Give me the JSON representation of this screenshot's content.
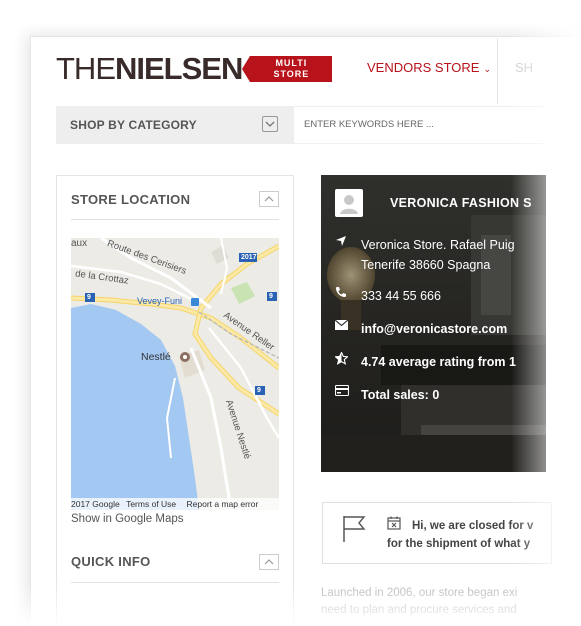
{
  "header": {
    "logo_thin": "THE",
    "logo_bold": "NIELSEN",
    "badge_line1": "MULTI",
    "badge_line2": "STORE",
    "nav_vendors": "VENDORS STORE",
    "nav_shop": "SH",
    "brand_color": "#b8121b"
  },
  "catbar": {
    "label": "SHOP BY CATEGORY",
    "toggle_icon": "chevron-down-icon"
  },
  "search": {
    "placeholder": "ENTER KEYWORDS HERE ..."
  },
  "sidebar": {
    "store_location_title": "STORE LOCATION",
    "map_labels": {
      "route_cerisiers": "Route des Cerisiers",
      "crottaz": "de la Crottaz",
      "vevey": "Vevey-Funi",
      "nestle": "Nestlé",
      "avenue_reller": "Avenue Reller",
      "avenue_nestle": "Avenue Nestlé",
      "aux": "aux",
      "road_9a": "9",
      "road_9b": "9",
      "road_9c": "9",
      "road_2017": "2017"
    },
    "map_footer": {
      "copyright": "2017 Google",
      "terms": "Terms of Use",
      "report": "Report a map error"
    },
    "map_link": "Show in Google Maps",
    "quick_info_title": "QUICK INFO"
  },
  "store": {
    "name": "VERONICA FASHION S",
    "address_line1": "Veronica Store. Rafael Puig",
    "address_line2": "Tenerife 38660 Spagna",
    "phone": "333 44 55 666",
    "email": "info@veronicastore.com",
    "rating": "4.74 average rating from 1",
    "sales": "Total sales: 0"
  },
  "notice": {
    "line1": "Hi, we are closed for v",
    "line2": "for the shipment of what y"
  },
  "description": {
    "line1": "Launched in 2006, our store began exi",
    "line2": "need to plan and procure services and"
  }
}
